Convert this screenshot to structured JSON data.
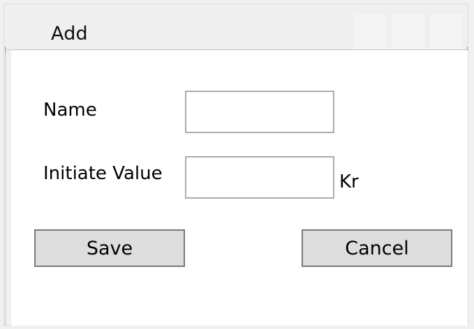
{
  "window": {
    "title": "Add",
    "caption_buttons": [
      "minimize-button",
      "maximize-button",
      "close-button"
    ]
  },
  "form": {
    "name_label": "Name",
    "name_value": "",
    "initiate_label": "Initiate Value",
    "initiate_value": "",
    "currency_unit": "Kr"
  },
  "buttons": {
    "save": "Save",
    "cancel": "Cancel"
  },
  "colors": {
    "window_background": "#f0f0f0",
    "content_background": "#ffffff",
    "button_background": "#dddddd",
    "field_border": "#acacac",
    "button_border": "#7a7a7a"
  }
}
